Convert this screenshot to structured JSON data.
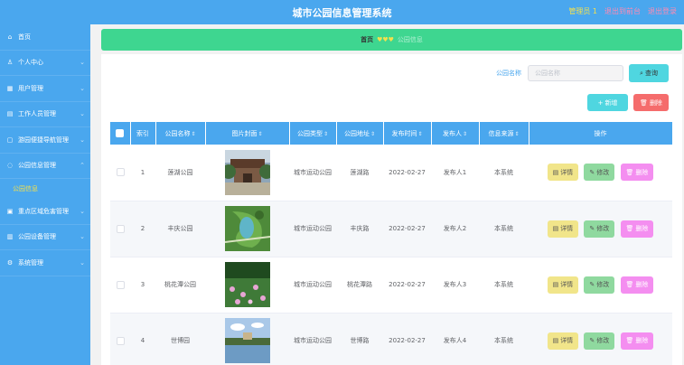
{
  "header": {
    "title": "城市公园信息管理系统",
    "role": "管理员 1",
    "back_label": "退出到前台",
    "logout_label": "退出登录"
  },
  "sidebar": {
    "items": [
      {
        "label": "首页",
        "icon": "home-icon"
      },
      {
        "label": "个人中心",
        "icon": "user-icon"
      },
      {
        "label": "用户管理",
        "icon": "users-icon"
      },
      {
        "label": "工作人员管理",
        "icon": "staff-icon"
      },
      {
        "label": "游园便捷导航管理",
        "icon": "navigation-icon"
      },
      {
        "label": "公园信息管理",
        "icon": "info-icon"
      },
      {
        "label": "公园信息",
        "submenu": true
      },
      {
        "label": "重点区域危害管理",
        "icon": "warning-icon"
      },
      {
        "label": "公园设备管理",
        "icon": "device-icon"
      },
      {
        "label": "系统管理",
        "icon": "settings-icon"
      }
    ]
  },
  "breadcrumb": {
    "home": "首页",
    "hearts": "♥♥♥",
    "current": "公园信息"
  },
  "search": {
    "label": "公园名称",
    "placeholder": "公园名称",
    "button": "查询"
  },
  "toolbar": {
    "add_label": "新增",
    "delete_label": "删除"
  },
  "table": {
    "headers": [
      "索引",
      "公园名称",
      "图片封面",
      "公园类型",
      "公园地址",
      "发布时间",
      "发布人",
      "信息来源",
      "操作"
    ],
    "rows": [
      {
        "index": "1",
        "name": "莲湖公园",
        "type": "城市运动公园",
        "address": "莲湖路",
        "date": "2022-02-27",
        "publisher": "发布人1",
        "source": "本系统"
      },
      {
        "index": "2",
        "name": "丰庆公园",
        "type": "城市运动公园",
        "address": "丰庆路",
        "date": "2022-02-27",
        "publisher": "发布人2",
        "source": "本系统"
      },
      {
        "index": "3",
        "name": "桃花潭公园",
        "type": "城市运动公园",
        "address": "桃花潭路",
        "date": "2022-02-27",
        "publisher": "发布人3",
        "source": "本系统"
      },
      {
        "index": "4",
        "name": "世博园",
        "type": "城市运动公园",
        "address": "世博路",
        "date": "2022-02-27",
        "publisher": "发布人4",
        "source": "本系统"
      }
    ],
    "actions": {
      "detail": "详情",
      "edit": "修改",
      "remove": "删除"
    }
  },
  "colors": {
    "primary": "#4aa7ee",
    "breadcrumb": "#3ed690",
    "accent_yellow": "#f4e04d",
    "danger": "#f56c6c"
  }
}
